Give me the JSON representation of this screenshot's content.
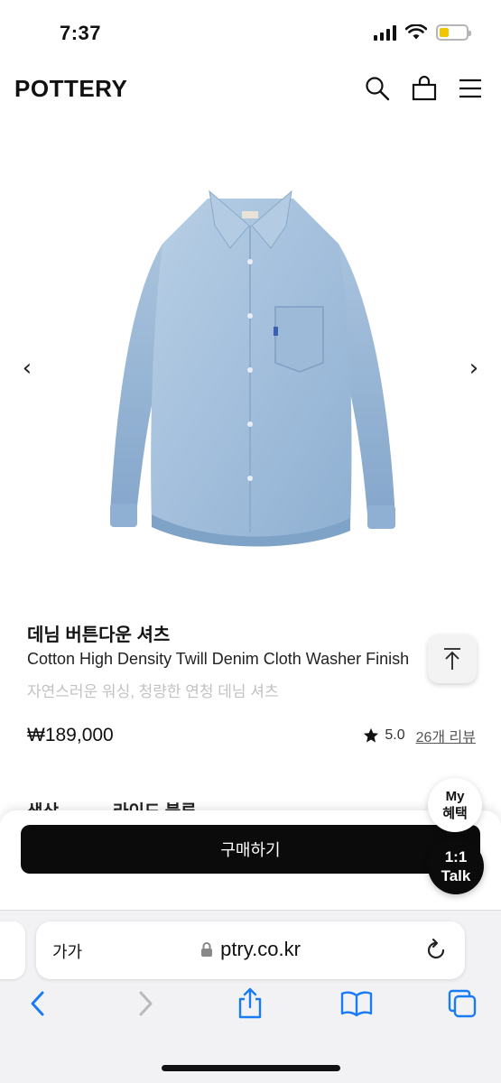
{
  "status_bar": {
    "time": "7:37"
  },
  "header": {
    "logo": "POTTERY"
  },
  "icons": {
    "search": "search-icon",
    "bag": "shopping-bag-icon",
    "menu": "hamburger-menu-icon",
    "prev": "chevron-left-icon",
    "next": "chevron-right-icon",
    "scroll_top": "scroll-to-top-icon",
    "star": "star-icon",
    "lock": "lock-icon",
    "reload": "reload-icon",
    "back": "back-icon",
    "forward": "forward-icon",
    "share": "share-icon",
    "bookmarks": "bookmarks-icon",
    "tabs": "tabs-icon"
  },
  "gallery": {
    "prev_arrow": "‹",
    "next_arrow": "›"
  },
  "product": {
    "title": "데님 버튼다운 셔츠",
    "subtitle": "Cotton High Density Twill Denim Cloth Washer Finish",
    "description": "자연스러운 워싱, 청량한 연청 데님 셔츠",
    "price": "₩189,000",
    "rating": "5.0",
    "reviews": "26개 리뷰"
  },
  "tabs_peek": [
    "색상",
    "라이드 블루"
  ],
  "buy": {
    "label": "구매하기"
  },
  "floating": {
    "my_line1": "My",
    "my_line2": "혜택",
    "talk_line1": "1:1",
    "talk_line2": "Talk"
  },
  "safari": {
    "text_size": "가가",
    "url": "ptry.co.kr"
  },
  "colors": {
    "buy_button": "#0b0b0b",
    "battery": "#f2c500",
    "safari_accent": "#1a7cf5",
    "denim": "#a9c3dd"
  }
}
